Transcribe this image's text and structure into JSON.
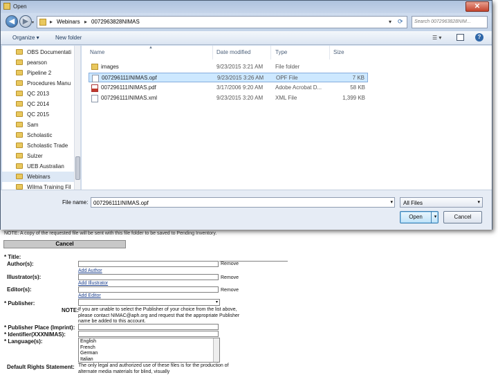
{
  "dialog": {
    "title": "Open",
    "close_glyph": "✕",
    "nav": {
      "back_glyph": "◀",
      "forward_glyph": "▶"
    },
    "address": {
      "crumbs": [
        "Webinars",
        "0072963828NIMAS"
      ],
      "separator": "▸"
    },
    "search_placeholder": "Search 0072963828NIM...",
    "toolbar": {
      "organize": "Organize ▾",
      "new_folder": "New folder"
    },
    "sidebar": [
      {
        "label": "OBS Documentati"
      },
      {
        "label": "pearson"
      },
      {
        "label": "Pipeline 2"
      },
      {
        "label": "Procedures Manu"
      },
      {
        "label": "QC 2013"
      },
      {
        "label": "QC 2014"
      },
      {
        "label": "QC 2015"
      },
      {
        "label": "Sam"
      },
      {
        "label": "Scholastic"
      },
      {
        "label": "Scholastic Trade"
      },
      {
        "label": "Sulzer"
      },
      {
        "label": "UEB Australian"
      },
      {
        "label": "Webinars"
      },
      {
        "label": "Wilma Training Fil"
      }
    ],
    "columns": [
      "Name",
      "Date modified",
      "Type",
      "Size"
    ],
    "files": [
      {
        "name": "images",
        "date": "9/23/2015 3:21 AM",
        "type": "File folder",
        "size": "",
        "icon": "folder-icon"
      },
      {
        "name": "007296111INIMAS.opf",
        "date": "9/23/2015 3:26 AM",
        "type": "OPF File",
        "size": "7 KB",
        "icon": "file-icon"
      },
      {
        "name": "007296111INIMAS.pdf",
        "date": "3/17/2006 9:20 AM",
        "type": "Adobe Acrobat D...",
        "size": "58 KB",
        "icon": "pdf-icon"
      },
      {
        "name": "007296111INIMAS.xml",
        "date": "9/23/2015 3:20 AM",
        "type": "XML File",
        "size": "1,399 KB",
        "icon": "file-icon"
      }
    ],
    "filename_label": "File name:",
    "filename_value": "007296111INIMAS.opf",
    "filetype_value": "All Files",
    "open_label": "Open",
    "cancel_label": "Cancel",
    "selected_row": 1,
    "colors": {
      "selection": "#cde8ff",
      "folder": "#e9c85e",
      "accent": "#3c7fb1"
    }
  },
  "form": {
    "note_text": "NOTE: A copy of the requested file will be sent with this file folder to be saved to Pending Inventory.",
    "cancel_label": "Cancel",
    "title_label": "* Title:",
    "authors_label": "Author(s):",
    "remove": "Remove",
    "add_author": "Add Author",
    "illustrators_label": "Illustrator(s):",
    "add_illustrator": "Add Illustrator",
    "editors_label": "Editor(s):",
    "add_editor": "Add Editor",
    "publisher_label": "* Publisher:",
    "publisher_note_label": "NOTE:",
    "publisher_note": "If you are unable to select the Publisher of your choice from the list above, please contact NIMAC@aph.org and request that the appropriate Publisher name be added to this account.",
    "publisher_place_label": "* Publisher Place (Imprint):",
    "identifier_label": "* Identifier(XXXNIMAS):",
    "language_label": "* Language(s):",
    "languages": [
      "English",
      "French",
      "German",
      "Italian"
    ],
    "rights_label": "Default Rights Statement:",
    "rights_text": "The only legal and authorized use of these files is for the production of alternate media materials for blind, visually"
  }
}
